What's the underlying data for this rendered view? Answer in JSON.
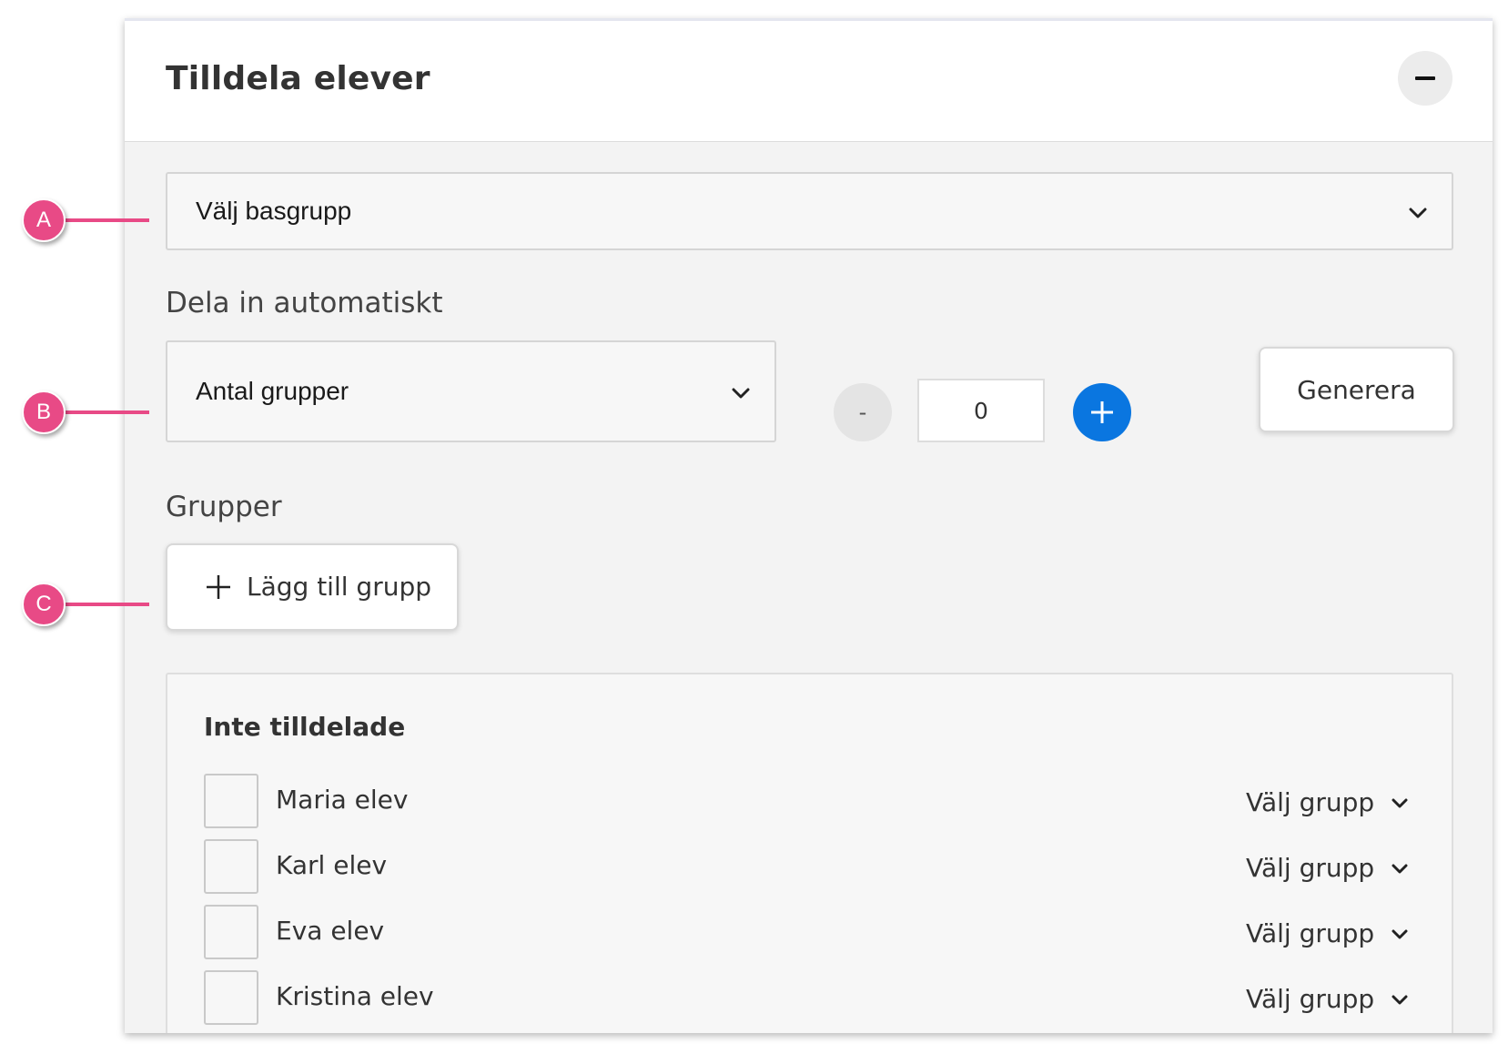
{
  "panel": {
    "title": "Tilldela elever",
    "collapse_icon": "minus-icon"
  },
  "basgrupp_select": {
    "label": "Välj basgrupp",
    "icon": "chevron-down-icon"
  },
  "auto_split": {
    "section_label": "Dela in automatiskt",
    "mode_select_label": "Antal grupper",
    "decrement_label": "-",
    "count_value": "0",
    "increment_icon": "plus-icon",
    "generate_label": "Generera"
  },
  "groups": {
    "section_label": "Grupper",
    "add_group_label": "Lägg till grupp",
    "add_group_icon": "plus-icon"
  },
  "unassigned": {
    "title": "Inte tilldelade",
    "students": [
      {
        "name": "Maria elev",
        "group_select": "Välj grupp"
      },
      {
        "name": "Karl elev",
        "group_select": "Välj grupp"
      },
      {
        "name": "Eva elev",
        "group_select": "Välj grupp"
      },
      {
        "name": "Kristina elev",
        "group_select": "Välj grupp"
      }
    ]
  },
  "callouts": [
    {
      "letter": "A"
    },
    {
      "letter": "B"
    },
    {
      "letter": "C"
    }
  ],
  "colors": {
    "accent_blue": "#0a76e0",
    "callout_pink": "#e84a86",
    "panel_bg": "#f3f3f3"
  }
}
